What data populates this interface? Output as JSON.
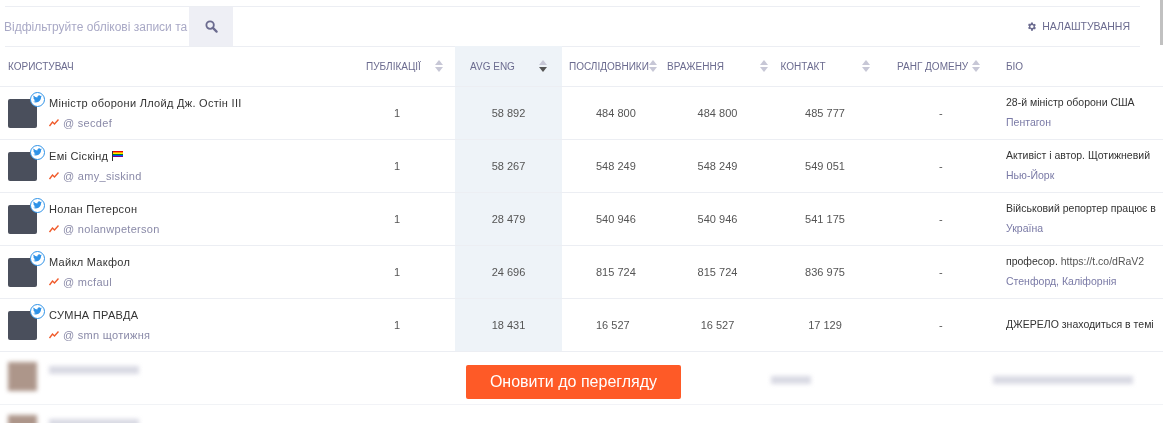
{
  "search": {
    "placeholder": "Відфільтруйте облікові записи та"
  },
  "settings": {
    "label": "НАЛАШТУВАННЯ"
  },
  "columns": [
    {
      "label": "КОРИСТУВАЧ",
      "sortable": false,
      "sorted": false
    },
    {
      "label": "ПУБЛІКАЦІЇ",
      "sortable": true,
      "sorted": false
    },
    {
      "label": "AVG ENG",
      "sortable": true,
      "sorted": true
    },
    {
      "label": "ПОСЛІДОВНИКИ",
      "sortable": true,
      "sorted": false
    },
    {
      "label": "ВРАЖЕННЯ",
      "sortable": true,
      "sorted": false
    },
    {
      "label": "КОНТАКТ",
      "sortable": true,
      "sorted": false
    },
    {
      "label": "РАНГ ДОМЕНУ",
      "sortable": true,
      "sorted": false
    },
    {
      "label": "БІО",
      "sortable": false,
      "sorted": false
    }
  ],
  "rows": [
    {
      "name": "Міністр оборони Ллойд Дж. Остін III",
      "flag": false,
      "handle": "@ secdef",
      "posts": "1",
      "avg_eng": "58 892",
      "followers": "484 800",
      "impressions": "484 800",
      "contact": "485 777",
      "domain_rank": "-",
      "bio": "28-й міністр оборони США",
      "location": "Пентагон"
    },
    {
      "name": "Емі Сіскінд",
      "flag": true,
      "handle": "@ amy_siskind",
      "posts": "1",
      "avg_eng": "58 267",
      "followers": "548 249",
      "impressions": "548 249",
      "contact": "549 051",
      "domain_rank": "-",
      "bio": "Активіст і автор. Щотижневий",
      "location": "Нью-Йорк"
    },
    {
      "name": "Нолан Петерсон",
      "flag": false,
      "handle": "@ nolanwpeterson",
      "posts": "1",
      "avg_eng": "28 479",
      "followers": "540 946",
      "impressions": "540 946",
      "contact": "541 175",
      "domain_rank": "-",
      "bio": "Військовий репортер працює в",
      "location": "Україна"
    },
    {
      "name": "Майкл Макфол",
      "flag": false,
      "handle": "@ mcfaul",
      "posts": "1",
      "avg_eng": "24 696",
      "followers": "815 724",
      "impressions": "815 724",
      "contact": "836 975",
      "domain_rank": "-",
      "bio": "професор.",
      "bio_link": "https://t.co/dRaV2",
      "location": "Стенфорд, Каліфорнія"
    },
    {
      "name": "СУМНА ПРАВДА",
      "flag": false,
      "handle": "@ smn щотижня",
      "posts": "1",
      "avg_eng": "18 431",
      "followers": "16 527",
      "impressions": "16 527",
      "contact": "17 129",
      "domain_rank": "-",
      "bio": "ДЖЕРЕЛО знаходиться в темі"
    }
  ],
  "locked_rows": [
    {
      "kind": "blurred"
    },
    {
      "kind": "blurred"
    }
  ],
  "upgrade_button": {
    "label": "Оновити до перегляду"
  }
}
